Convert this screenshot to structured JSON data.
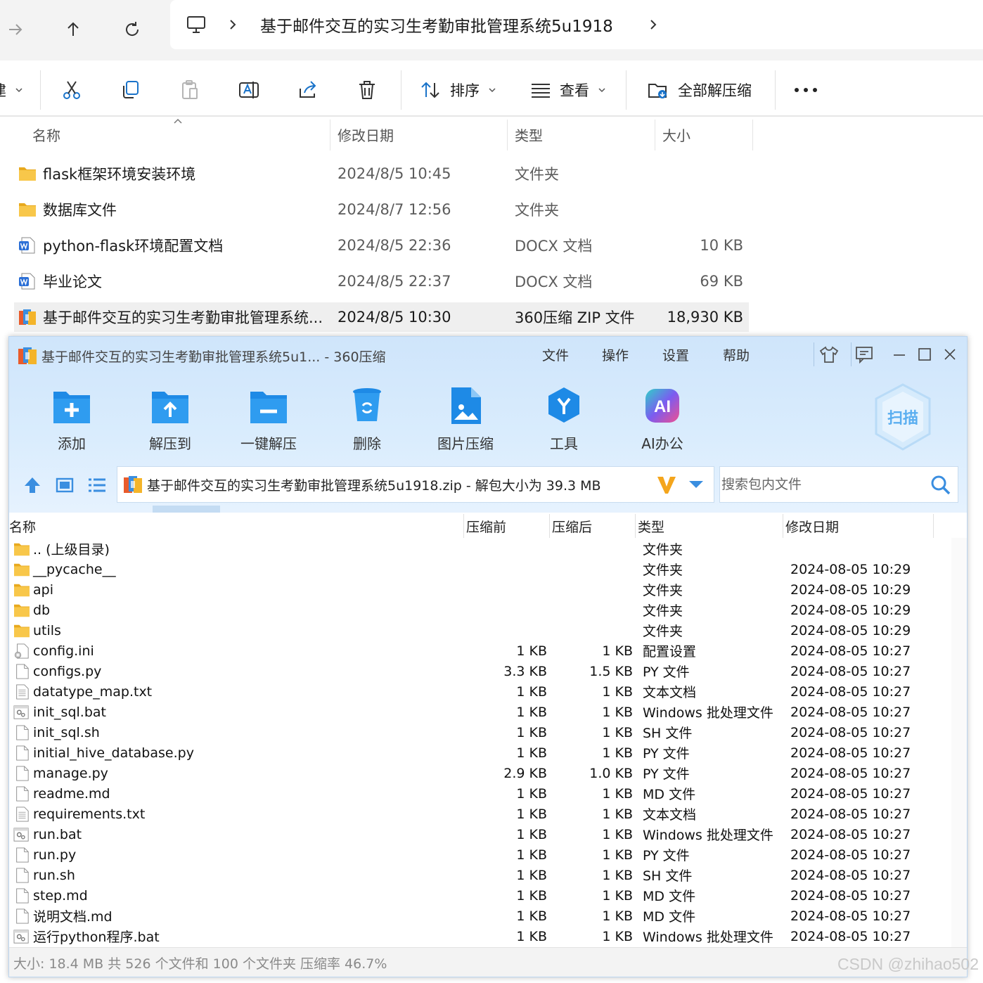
{
  "explorer": {
    "address": {
      "folder": "基于邮件交互的实习生考勤审批管理系统5u1918"
    },
    "toolbar": {
      "new_partial": "建",
      "sort_label": "排序",
      "view_label": "查看",
      "extract_all_label": "全部解压缩"
    },
    "columns": {
      "name": "名称",
      "date": "修改日期",
      "type": "类型",
      "size": "大小"
    },
    "rows": [
      {
        "name": "flask框架环境安装环境",
        "date": "2024/8/5 10:45",
        "type": "文件夹",
        "size": "",
        "icon": "folder-icon"
      },
      {
        "name": "数据库文件",
        "date": "2024/8/7 12:56",
        "type": "文件夹",
        "size": "",
        "icon": "folder-icon"
      },
      {
        "name": "python-flask环境配置文档",
        "date": "2024/8/5 22:36",
        "type": "DOCX 文档",
        "size": "10 KB",
        "icon": "word-doc-icon"
      },
      {
        "name": "毕业论文",
        "date": "2024/8/5 22:37",
        "type": "DOCX 文档",
        "size": "69 KB",
        "icon": "word-doc-icon"
      },
      {
        "name": "基于邮件交互的实习生考勤审批管理系统...",
        "date": "2024/8/5 10:30",
        "type": "360压缩 ZIP 文件",
        "size": "18,930 KB",
        "icon": "zip-archive-icon"
      }
    ]
  },
  "zip_window": {
    "title": "基于邮件交互的实习生考勤审批管理系统5u1... - 360压缩",
    "menu": [
      "文件",
      "操作",
      "设置",
      "帮助"
    ],
    "tools": [
      "添加",
      "解压到",
      "一键解压",
      "删除",
      "图片压缩",
      "工具",
      "AI办公"
    ],
    "scan_label": "扫描",
    "ai_badge": "AI",
    "path_text": "基于邮件交互的实习生考勤审批管理系统5u1918.zip - 解包大小为 39.3 MB",
    "search_placeholder": "搜索包内文件",
    "columns": {
      "name": "名称",
      "before": "压缩前",
      "after": "压缩后",
      "type": "类型",
      "date": "修改日期"
    },
    "rows": [
      {
        "name": ".. (上级目录)",
        "before": "",
        "after": "",
        "type": "文件夹",
        "date": "",
        "icon": "folder-icon"
      },
      {
        "name": "__pycache__",
        "before": "",
        "after": "",
        "type": "文件夹",
        "date": "2024-08-05 10:29",
        "icon": "folder-icon"
      },
      {
        "name": "api",
        "before": "",
        "after": "",
        "type": "文件夹",
        "date": "2024-08-05 10:29",
        "icon": "folder-icon"
      },
      {
        "name": "db",
        "before": "",
        "after": "",
        "type": "文件夹",
        "date": "2024-08-05 10:29",
        "icon": "folder-icon"
      },
      {
        "name": "utils",
        "before": "",
        "after": "",
        "type": "文件夹",
        "date": "2024-08-05 10:29",
        "icon": "folder-icon"
      },
      {
        "name": "config.ini",
        "before": "1 KB",
        "after": "1 KB",
        "type": "配置设置",
        "date": "2024-08-05 10:27",
        "icon": "config-file-icon"
      },
      {
        "name": "configs.py",
        "before": "3.3 KB",
        "after": "1.5 KB",
        "type": "PY 文件",
        "date": "2024-08-05 10:27",
        "icon": "file-icon"
      },
      {
        "name": "datatype_map.txt",
        "before": "1 KB",
        "after": "1 KB",
        "type": "文本文档",
        "date": "2024-08-05 10:27",
        "icon": "text-file-icon"
      },
      {
        "name": "init_sql.bat",
        "before": "1 KB",
        "after": "1 KB",
        "type": "Windows 批处理文件",
        "date": "2024-08-05 10:27",
        "icon": "batch-file-icon"
      },
      {
        "name": "init_sql.sh",
        "before": "1 KB",
        "after": "1 KB",
        "type": "SH 文件",
        "date": "2024-08-05 10:27",
        "icon": "file-icon"
      },
      {
        "name": "initial_hive_database.py",
        "before": "1 KB",
        "after": "1 KB",
        "type": "PY 文件",
        "date": "2024-08-05 10:27",
        "icon": "file-icon"
      },
      {
        "name": "manage.py",
        "before": "2.9 KB",
        "after": "1.0 KB",
        "type": "PY 文件",
        "date": "2024-08-05 10:27",
        "icon": "file-icon"
      },
      {
        "name": "readme.md",
        "before": "1 KB",
        "after": "1 KB",
        "type": "MD 文件",
        "date": "2024-08-05 10:27",
        "icon": "file-icon"
      },
      {
        "name": "requirements.txt",
        "before": "1 KB",
        "after": "1 KB",
        "type": "文本文档",
        "date": "2024-08-05 10:27",
        "icon": "text-file-icon"
      },
      {
        "name": "run.bat",
        "before": "1 KB",
        "after": "1 KB",
        "type": "Windows 批处理文件",
        "date": "2024-08-05 10:27",
        "icon": "batch-file-icon"
      },
      {
        "name": "run.py",
        "before": "1 KB",
        "after": "1 KB",
        "type": "PY 文件",
        "date": "2024-08-05 10:27",
        "icon": "file-icon"
      },
      {
        "name": "run.sh",
        "before": "1 KB",
        "after": "1 KB",
        "type": "SH 文件",
        "date": "2024-08-05 10:27",
        "icon": "file-icon"
      },
      {
        "name": "step.md",
        "before": "1 KB",
        "after": "1 KB",
        "type": "MD 文件",
        "date": "2024-08-05 10:27",
        "icon": "file-icon"
      },
      {
        "name": "说明文档.md",
        "before": "1 KB",
        "after": "1 KB",
        "type": "MD 文件",
        "date": "2024-08-05 10:27",
        "icon": "file-icon"
      },
      {
        "name": "运行python程序.bat",
        "before": "1 KB",
        "after": "1 KB",
        "type": "Windows 批处理文件",
        "date": "2024-08-05 10:27",
        "icon": "batch-file-icon"
      }
    ],
    "status": "大小: 18.4 MB 共 526 个文件和 100 个文件夹 压缩率 46.7%"
  },
  "watermark": "CSDN @zhihao502",
  "colors": {
    "zip_accent": "#1e8ae6",
    "folder": "#f8c74a",
    "word": "#2b6fd6",
    "selection": "#efefef"
  }
}
